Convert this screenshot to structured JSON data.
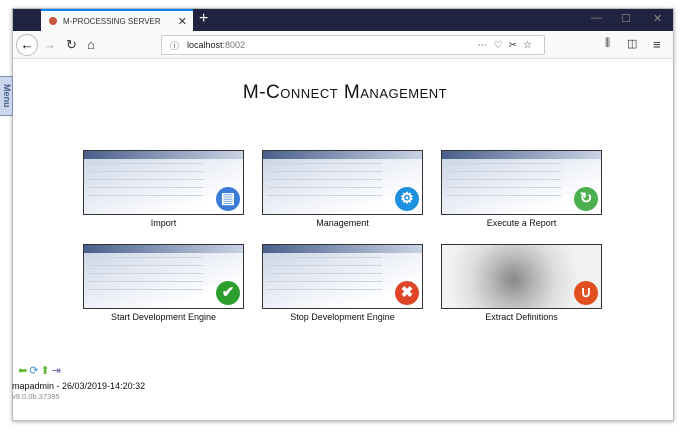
{
  "browser": {
    "tab_title": "M-PROCESSING SERVER",
    "url_host": "localhost",
    "url_port": ":8002"
  },
  "menu_label": "Menu",
  "page_title": "M-Connect Management",
  "tiles": [
    {
      "label": "Import",
      "icon": "floppy-import-icon",
      "color": "#3a7bd5",
      "glyph": "▤"
    },
    {
      "label": "Management",
      "icon": "gear-icon",
      "color": "#1e90e0",
      "glyph": "⚙"
    },
    {
      "label": "Execute a Report",
      "icon": "report-refresh-icon",
      "color": "#4caf50",
      "glyph": "↻"
    },
    {
      "label": "Start Development Engine",
      "icon": "check-icon",
      "color": "#2e9e2e",
      "glyph": "✔"
    },
    {
      "label": "Stop Development Engine",
      "icon": "stop-x-icon",
      "color": "#e0452a",
      "glyph": "✖"
    },
    {
      "label": "Extract Definitions",
      "icon": "magnet-icon",
      "color": "#e05020",
      "glyph": "∪"
    }
  ],
  "footer": {
    "user": "mapadmin - 26/03/2019-14:20:32",
    "version": "v9.0.0b.37395"
  }
}
